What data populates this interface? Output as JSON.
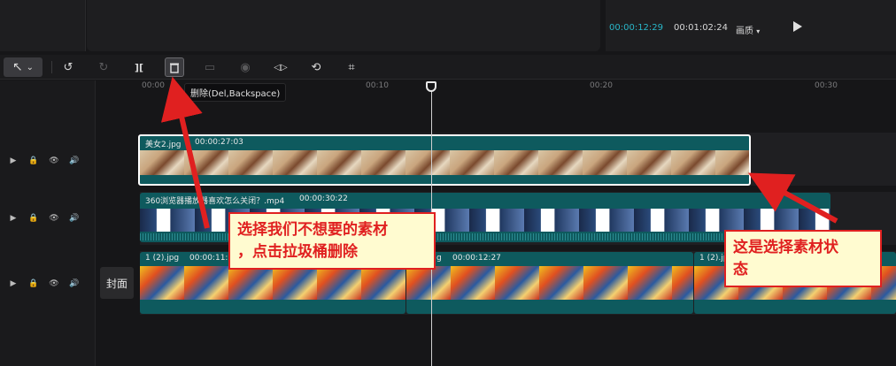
{
  "player": {
    "current_time": "00:00:12:29",
    "total_time": "00:01:02:24",
    "quality_label": "画质",
    "quality_caret": "▾",
    "play_icon": "play-icon"
  },
  "toolbar": {
    "select_icon": "cursor-arrow-icon",
    "select_caret": "⌄",
    "undo": "↺",
    "redo": "↻",
    "split": "][",
    "delete": "🗑",
    "freeze": "▭",
    "record": "◉",
    "mirror": "◁▷",
    "rotate": "⟲",
    "crop": "⌗"
  },
  "tooltip": {
    "text": "删除(Del,Backspace)"
  },
  "ruler": {
    "labels": [
      "00:00",
      "00:10",
      "00:20",
      "00:30"
    ]
  },
  "tracks": [
    {
      "clips": [
        {
          "name": "美女2.jpg",
          "duration": "00:00:27:03"
        }
      ]
    },
    {
      "clips": [
        {
          "name": "360浏览器播放器喜欢怎么关闭？.mp4",
          "duration": "00:00:30:22"
        }
      ]
    },
    {
      "clips": [
        {
          "name": "1 (2).jpg",
          "duration": "00:00:11:"
        },
        {
          "name": "g",
          "duration": "00:00:12:27"
        },
        {
          "name": "1 (2).jpg",
          "duration": ""
        }
      ]
    }
  ],
  "track_controls": {
    "video": "▶",
    "lock": "🔒",
    "eye": "👁",
    "audio": "🔊"
  },
  "cover_label": "封面",
  "annotations": {
    "left_note_line1": "选择我们不想要的素材",
    "left_note_line2": "，点击拉圾桶删除",
    "right_note_line1": "这是选择素材状",
    "right_note_line2": "态"
  },
  "colors": {
    "accent": "#29b6c8",
    "annotation_red": "#e02020",
    "clip_teal": "#0e5a5e"
  }
}
